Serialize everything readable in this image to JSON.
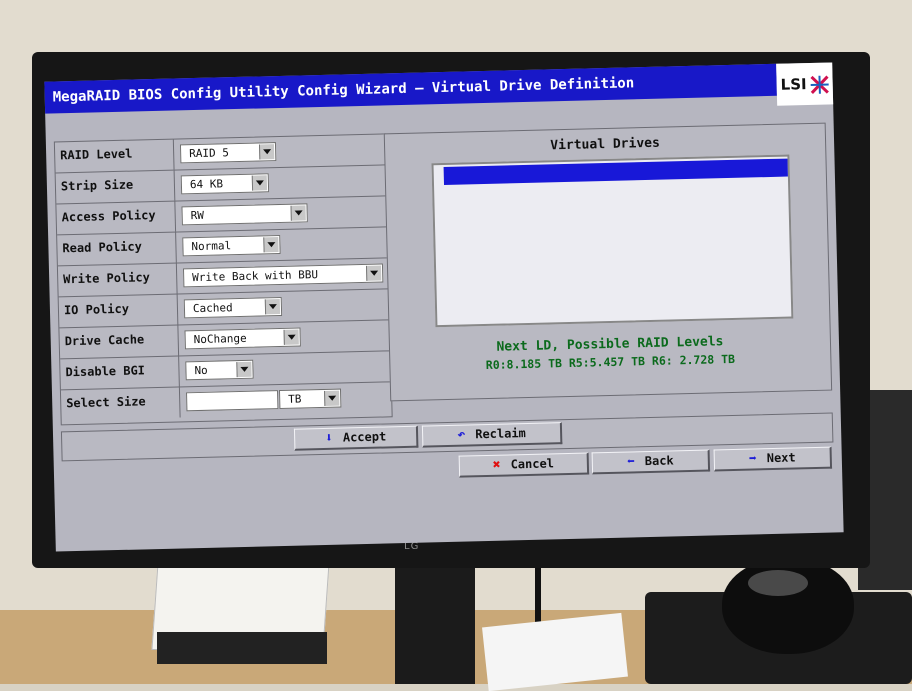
{
  "window": {
    "title": "MegaRAID BIOS Config Utility  Config Wizard – Virtual Drive Definition",
    "logo_text": "LSI"
  },
  "form": {
    "fields": [
      {
        "label": "RAID Level",
        "value": "RAID 5"
      },
      {
        "label": "Strip Size",
        "value": "64 KB"
      },
      {
        "label": "Access Policy",
        "value": "RW"
      },
      {
        "label": "Read Policy",
        "value": "Normal"
      },
      {
        "label": "Write Policy",
        "value": "Write Back with BBU"
      },
      {
        "label": "IO Policy",
        "value": "Cached"
      },
      {
        "label": "Drive Cache",
        "value": "NoChange"
      },
      {
        "label": "Disable BGI",
        "value": "No"
      },
      {
        "label": "Select Size",
        "value": ""
      }
    ],
    "size_unit": "TB"
  },
  "virtual_drives": {
    "title": "Virtual Drives",
    "items": [
      ""
    ],
    "next_ld_title": "Next LD, Possible RAID Levels",
    "next_ld_values": "R0:8.185 TB  R5:5.457 TB  R6: 2.728 TB"
  },
  "actions": {
    "accept_label": "Accept",
    "reclaim_label": "Reclaim",
    "cancel_label": "Cancel",
    "back_label": "Back",
    "next_label": "Next"
  },
  "icons": {
    "accept": "down-arrow-icon",
    "reclaim": "reclaim-icon",
    "cancel": "red-x-icon",
    "back": "left-arrow-icon",
    "next": "right-arrow-icon"
  },
  "colors": {
    "title_bar": "#1818c8",
    "selection": "#1818d8",
    "status_text": "#0b6a1c",
    "screen_bg": "#b6b6c0"
  },
  "monitor": {
    "brand": "LG"
  }
}
